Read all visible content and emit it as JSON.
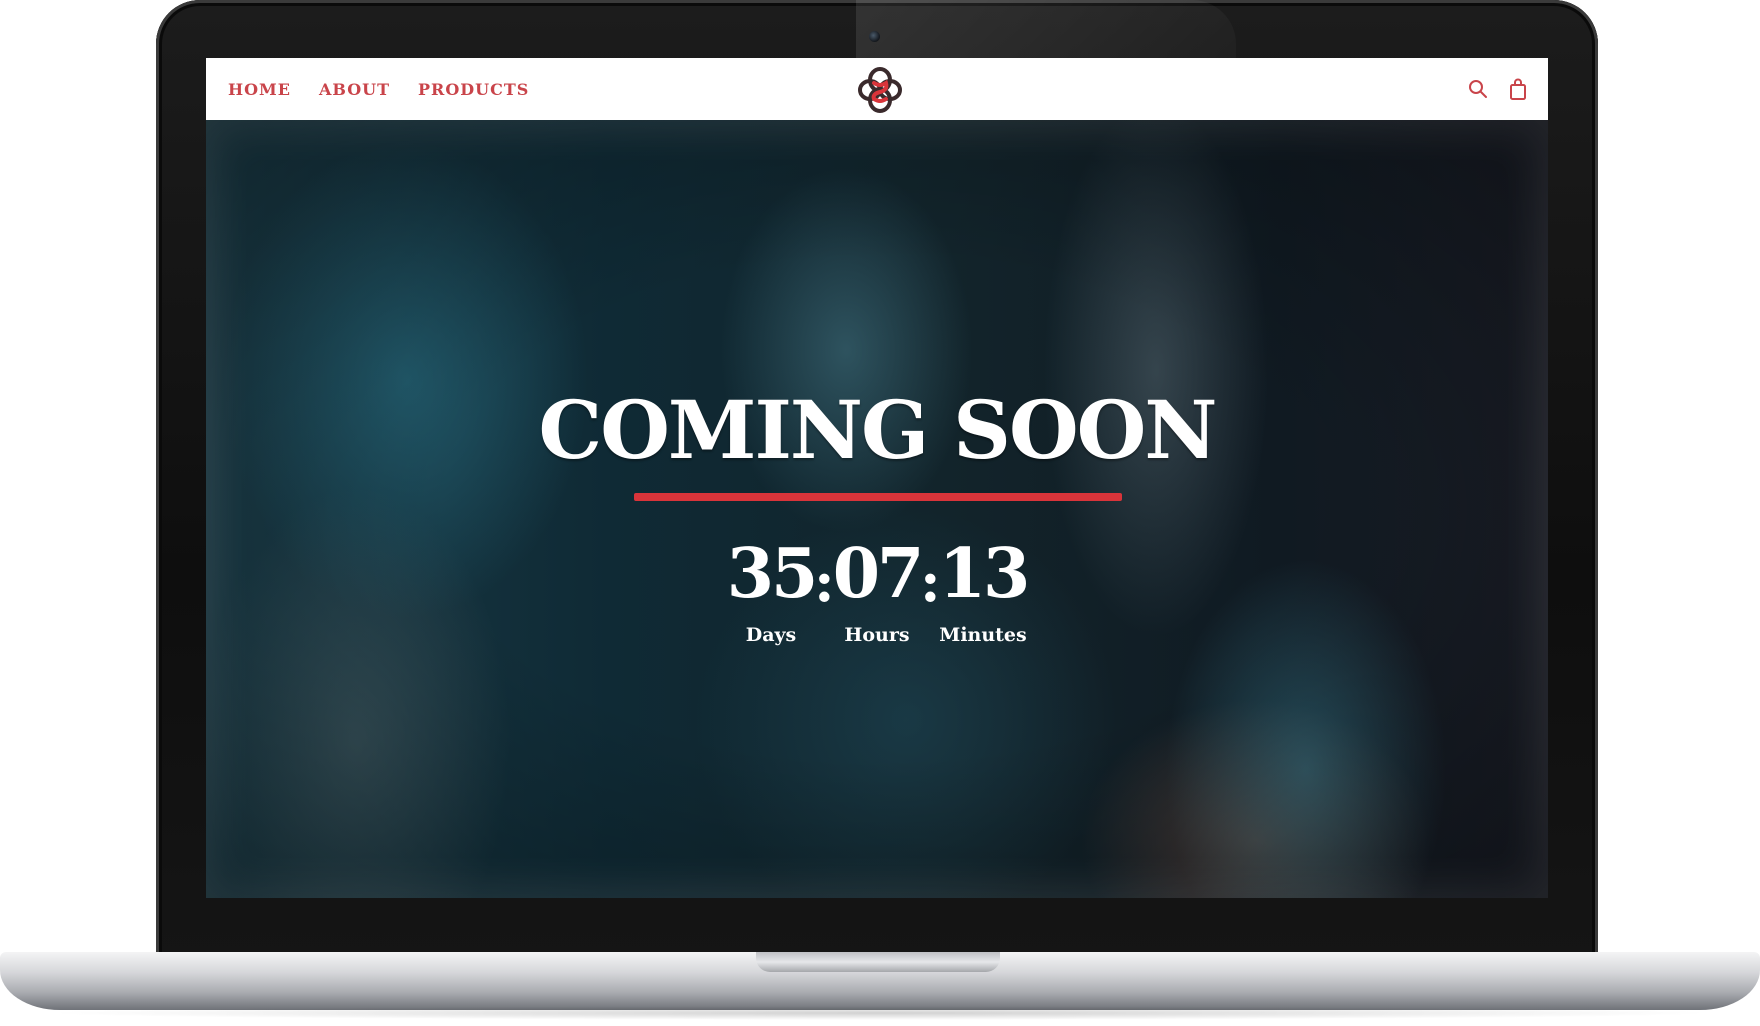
{
  "nav": {
    "items": [
      {
        "label": "HOME"
      },
      {
        "label": "ABOUT"
      },
      {
        "label": "PRODUCTS"
      }
    ]
  },
  "header": {
    "logo_icon": "interlocking-knot-logo",
    "search_icon": "search-icon",
    "cart_icon": "shopping-bag-icon"
  },
  "hero": {
    "headline": "COMING SOON",
    "countdown": {
      "days": {
        "value": "35",
        "label": "Days"
      },
      "hours": {
        "value": "07",
        "label": "Hours"
      },
      "minutes": {
        "value": "13",
        "label": "Minutes"
      },
      "separator": ":"
    }
  },
  "colors": {
    "accent_red": "#d9343a",
    "nav_text": "#c9444a",
    "header_bg": "#ffffff",
    "headline_text": "#ffffff"
  }
}
